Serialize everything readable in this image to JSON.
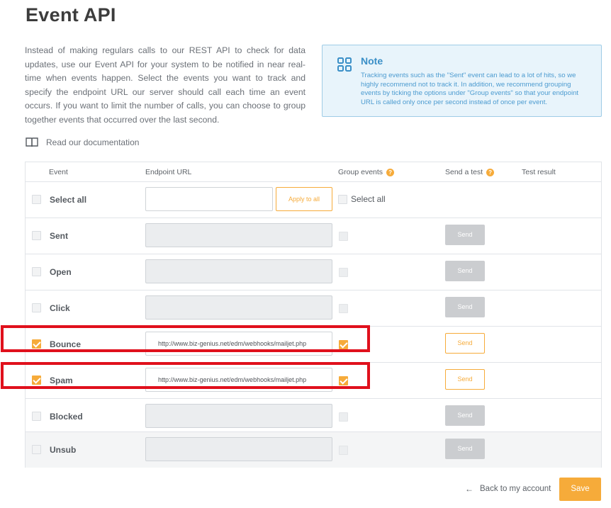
{
  "page": {
    "title": "Event API",
    "intro": "Instead of making regulars calls to our REST API to check for data updates, use our Event API for your system to be notified in near real-time when events happen. Select the events you want to track and specify the endpoint URL our server should call each time an event occurs. If you want to limit the number of calls, you can choose to group together events that occurred over the last second."
  },
  "note": {
    "icon": "grid-icon",
    "title": "Note",
    "text": "Tracking events such as the \"Sent\" event can lead to a lot of hits, so we highly recommend not to track it. In addition, we recommend grouping events by ticking the options under \"Group events\" so that your endpoint URL is called only once per second instead of once per event.",
    "color": "#4c9bd0"
  },
  "documentation": {
    "icon": "book-icon",
    "label": "Read our documentation"
  },
  "table": {
    "headers": {
      "event": "Event",
      "endpoint": "Endpoint URL",
      "group": "Group events",
      "send_test": "Send a test",
      "result": "Test result"
    },
    "select_all": {
      "label": "Select all",
      "endpoint_value": "",
      "apply_label": "Apply to all",
      "group_label": "Select all"
    },
    "rows": [
      {
        "event": "Sent",
        "checked": false,
        "url": "",
        "group": false,
        "send": "Send"
      },
      {
        "event": "Open",
        "checked": false,
        "url": "",
        "group": false,
        "send": "Send"
      },
      {
        "event": "Click",
        "checked": false,
        "url": "",
        "group": false,
        "send": "Send"
      },
      {
        "event": "Bounce",
        "checked": true,
        "url": "http://www.biz-genius.net/edm/webhooks/mailjet.php",
        "group": true,
        "send": "Send"
      },
      {
        "event": "Spam",
        "checked": true,
        "url": "http://www.biz-genius.net/edm/webhooks/mailjet.php",
        "group": true,
        "send": "Send"
      },
      {
        "event": "Blocked",
        "checked": false,
        "url": "",
        "group": false,
        "send": "Send"
      },
      {
        "event": "Unsub",
        "checked": false,
        "url": "",
        "group": false,
        "send": "Send"
      }
    ]
  },
  "footer": {
    "back_label": "Back to my account",
    "save_label": "Save"
  },
  "colors": {
    "accent": "#f6ab3a",
    "highlight": "#e0101c",
    "note_border": "#9fcce6"
  }
}
